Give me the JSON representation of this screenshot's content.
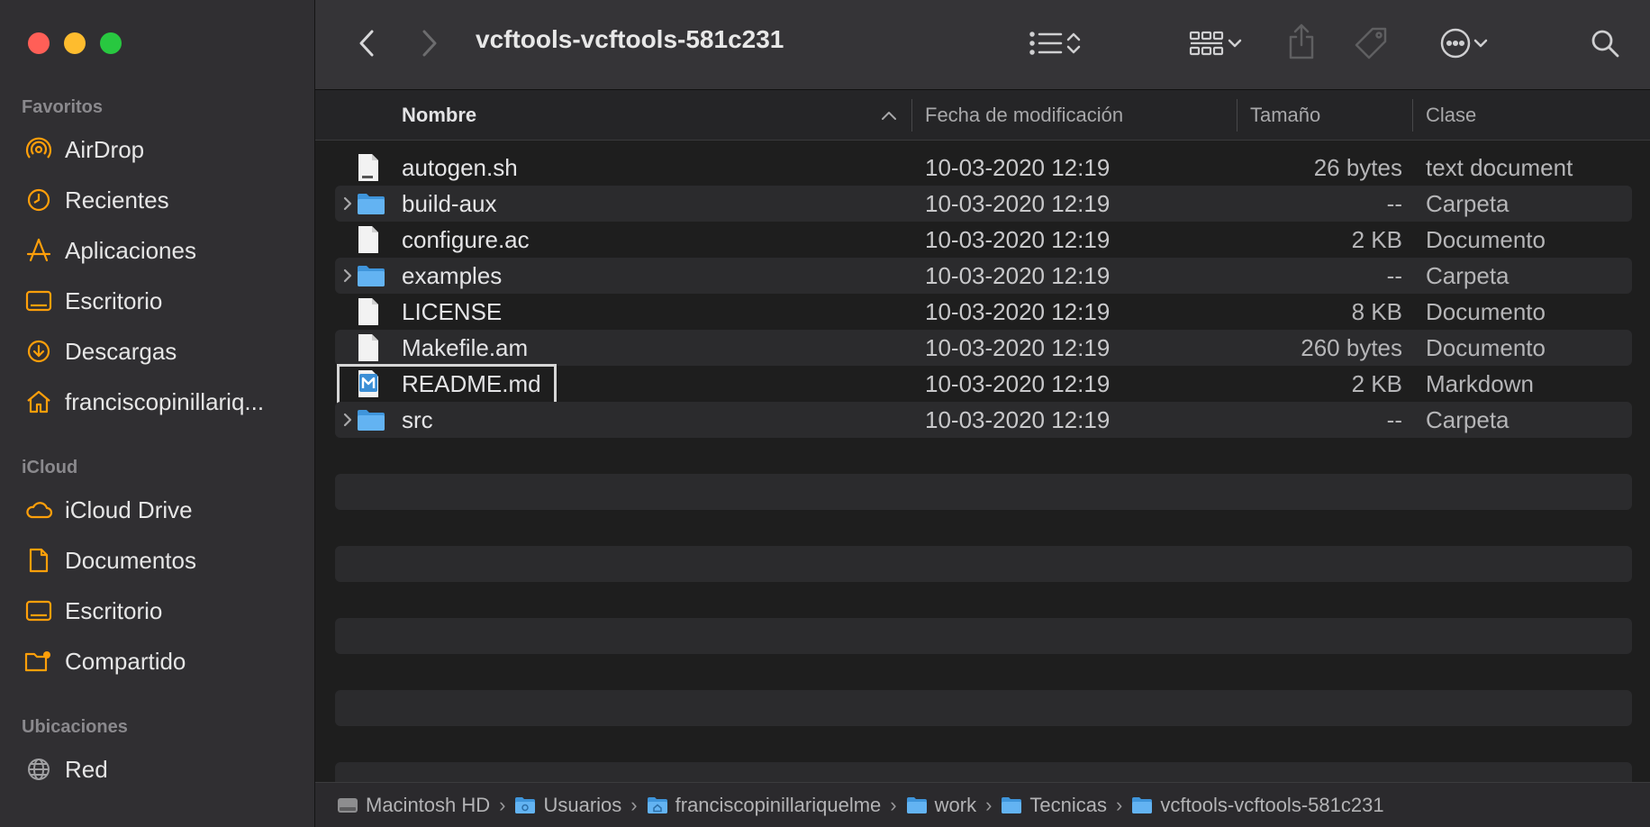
{
  "window": {
    "title": "vcftools-vcftools-581c231"
  },
  "colors": {
    "close": "#ff5f57",
    "minimize": "#febc2e",
    "zoom": "#28c840",
    "accent": "#ff9f0a",
    "folder": "#5aaef0"
  },
  "sidebar": {
    "sections": [
      {
        "title": "Favoritos",
        "items": [
          {
            "label": "AirDrop",
            "icon": "airdrop-icon"
          },
          {
            "label": "Recientes",
            "icon": "clock-icon"
          },
          {
            "label": "Aplicaciones",
            "icon": "applications-icon"
          },
          {
            "label": "Escritorio",
            "icon": "desktop-icon"
          },
          {
            "label": "Descargas",
            "icon": "download-icon"
          },
          {
            "label": "franciscopinillariq...",
            "icon": "home-icon"
          }
        ]
      },
      {
        "title": "iCloud",
        "items": [
          {
            "label": "iCloud Drive",
            "icon": "cloud-icon"
          },
          {
            "label": "Documentos",
            "icon": "document-icon"
          },
          {
            "label": "Escritorio",
            "icon": "desktop-icon"
          },
          {
            "label": "Compartido",
            "icon": "shared-folder-icon"
          }
        ]
      },
      {
        "title": "Ubicaciones",
        "items": [
          {
            "label": "Red",
            "icon": "network-icon"
          }
        ]
      }
    ]
  },
  "columns": {
    "name": "Nombre",
    "date": "Fecha de modificación",
    "size": "Tamaño",
    "kind": "Clase"
  },
  "files": [
    {
      "name": "autogen.sh",
      "date": "10-03-2020 12:19",
      "size": "26 bytes",
      "kind": "text document",
      "type": "shell",
      "expandable": false
    },
    {
      "name": "build-aux",
      "date": "10-03-2020 12:19",
      "size": "--",
      "kind": "Carpeta",
      "type": "folder",
      "expandable": true
    },
    {
      "name": "configure.ac",
      "date": "10-03-2020 12:19",
      "size": "2 KB",
      "kind": "Documento",
      "type": "doc",
      "expandable": false
    },
    {
      "name": "examples",
      "date": "10-03-2020 12:19",
      "size": "--",
      "kind": "Carpeta",
      "type": "folder",
      "expandable": true
    },
    {
      "name": "LICENSE",
      "date": "10-03-2020 12:19",
      "size": "8 KB",
      "kind": "Documento",
      "type": "doc",
      "expandable": false
    },
    {
      "name": "Makefile.am",
      "date": "10-03-2020 12:19",
      "size": "260 bytes",
      "kind": "Documento",
      "type": "doc",
      "expandable": false
    },
    {
      "name": "README.md",
      "date": "10-03-2020 12:19",
      "size": "2 KB",
      "kind": "Markdown",
      "type": "markdown",
      "expandable": false,
      "selected": true
    },
    {
      "name": "src",
      "date": "10-03-2020 12:19",
      "size": "--",
      "kind": "Carpeta",
      "type": "folder",
      "expandable": true
    }
  ],
  "pathbar": [
    {
      "label": "Macintosh HD",
      "icon": "disk-icon"
    },
    {
      "label": "Usuarios",
      "icon": "folder-icon"
    },
    {
      "label": "franciscopinillariquelme",
      "icon": "home-folder-icon"
    },
    {
      "label": "work",
      "icon": "folder-icon"
    },
    {
      "label": "Tecnicas",
      "icon": "folder-icon"
    },
    {
      "label": "vcftools-vcftools-581c231",
      "icon": "folder-icon"
    }
  ]
}
